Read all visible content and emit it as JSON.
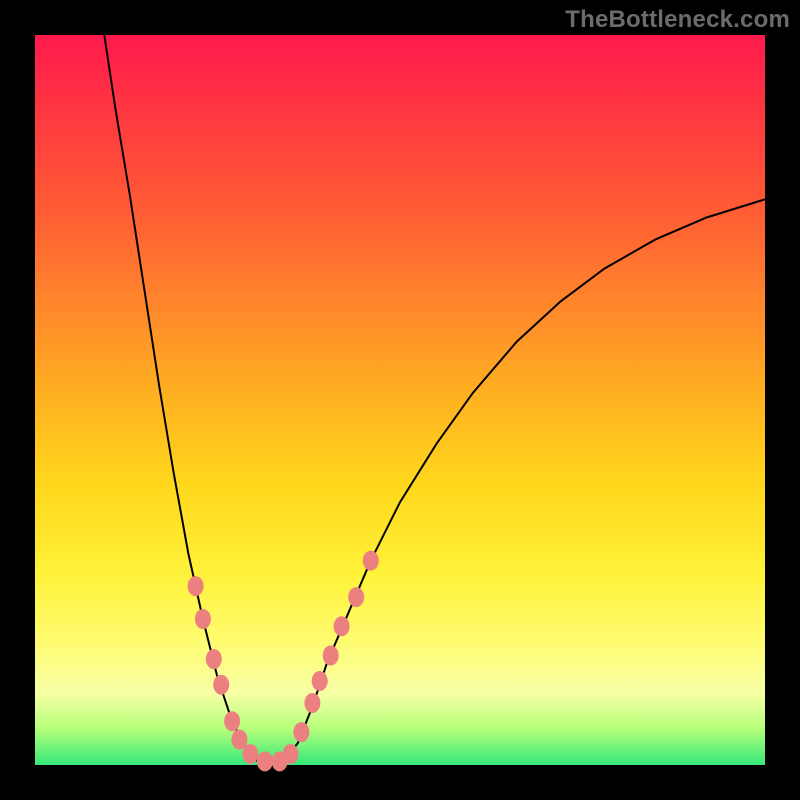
{
  "watermark": "TheBottleneck.com",
  "colors": {
    "background": "#000000",
    "marker": "#ec8080",
    "curve": "#000000",
    "gradient_top": "#ff1a4d",
    "gradient_bottom": "#34e87a"
  },
  "chart_data": {
    "type": "line",
    "title": "",
    "xlabel": "",
    "ylabel": "",
    "xlim": [
      0,
      100
    ],
    "ylim": [
      0,
      100
    ],
    "axes_visible": false,
    "legend": false,
    "curve_segments": [
      {
        "name": "left-arm",
        "points_xy": [
          [
            9.5,
            100
          ],
          [
            11,
            90
          ],
          [
            13,
            78
          ],
          [
            15,
            65
          ],
          [
            17,
            52
          ],
          [
            19,
            40
          ],
          [
            21,
            29
          ],
          [
            23,
            20
          ],
          [
            25,
            12
          ],
          [
            27,
            6
          ],
          [
            29,
            2
          ],
          [
            30.5,
            0.5
          ]
        ]
      },
      {
        "name": "floor",
        "points_xy": [
          [
            30.5,
            0.5
          ],
          [
            34,
            0.5
          ]
        ]
      },
      {
        "name": "right-arm",
        "points_xy": [
          [
            34,
            0.5
          ],
          [
            36,
            3
          ],
          [
            38,
            8
          ],
          [
            40,
            14
          ],
          [
            43,
            21
          ],
          [
            46,
            28
          ],
          [
            50,
            36
          ],
          [
            55,
            44
          ],
          [
            60,
            51
          ],
          [
            66,
            58
          ],
          [
            72,
            63.5
          ],
          [
            78,
            68
          ],
          [
            85,
            72
          ],
          [
            92,
            75
          ],
          [
            100,
            77.5
          ]
        ]
      }
    ],
    "series": [
      {
        "name": "left-markers",
        "type": "scatter",
        "points_xy": [
          [
            22.0,
            24.5
          ],
          [
            23.0,
            20.0
          ],
          [
            24.5,
            14.5
          ],
          [
            25.5,
            11.0
          ],
          [
            27.0,
            6.0
          ],
          [
            28.0,
            3.5
          ],
          [
            29.5,
            1.5
          ],
          [
            31.5,
            0.5
          ],
          [
            33.5,
            0.5
          ]
        ]
      },
      {
        "name": "right-markers",
        "type": "scatter",
        "points_xy": [
          [
            35.0,
            1.5
          ],
          [
            36.5,
            4.5
          ],
          [
            38.0,
            8.5
          ],
          [
            39.0,
            11.5
          ],
          [
            40.5,
            15.0
          ],
          [
            42.0,
            19.0
          ],
          [
            44.0,
            23.0
          ],
          [
            46.0,
            28.0
          ]
        ]
      }
    ]
  }
}
